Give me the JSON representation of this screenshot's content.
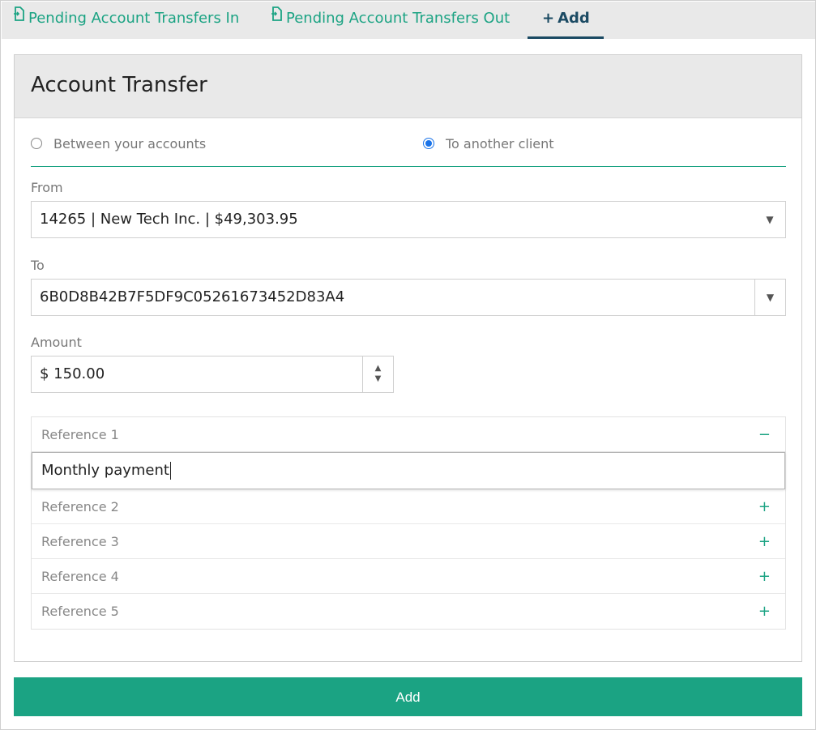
{
  "tabs": {
    "transfers_in": "Pending Account Transfers In",
    "transfers_out": "Pending Account Transfers Out",
    "add": "Add"
  },
  "panel": {
    "title": "Account Transfer"
  },
  "transfer_type": {
    "between": "Between your accounts",
    "another": "To another client",
    "selected": "To another client"
  },
  "from": {
    "label": "From",
    "value": "14265 | New Tech Inc. | $49,303.95"
  },
  "to": {
    "label": "To",
    "value": "6B0D8B42B7F5DF9C05261673452D83A4"
  },
  "amount": {
    "label": "Amount",
    "value": "$ 150.00"
  },
  "references": [
    {
      "label": "Reference 1",
      "toggle": "−",
      "value": "Monthly payment"
    },
    {
      "label": "Reference 2",
      "toggle": "+"
    },
    {
      "label": "Reference 3",
      "toggle": "+"
    },
    {
      "label": "Reference 4",
      "toggle": "+"
    },
    {
      "label": "Reference 5",
      "toggle": "+"
    }
  ],
  "submit_label": "Add",
  "colors": {
    "accent": "#1ba383",
    "active_tab": "#1b4a63",
    "radio_checked": "#1a73e8"
  }
}
